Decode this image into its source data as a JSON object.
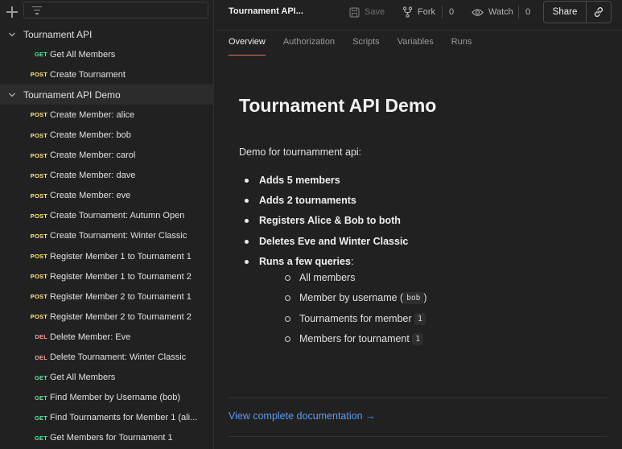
{
  "sidebar": {
    "filter_placeholder": "",
    "items": [
      {
        "kind": "folder",
        "label": "Tournament API",
        "active": false
      },
      {
        "kind": "req",
        "method": "GET",
        "label": "Get All Members"
      },
      {
        "kind": "req",
        "method": "POST",
        "label": "Create Tournament"
      },
      {
        "kind": "folder",
        "label": "Tournament API Demo",
        "active": true
      },
      {
        "kind": "req",
        "method": "POST",
        "label": "Create Member: alice"
      },
      {
        "kind": "req",
        "method": "POST",
        "label": "Create Member: bob"
      },
      {
        "kind": "req",
        "method": "POST",
        "label": "Create Member: carol"
      },
      {
        "kind": "req",
        "method": "POST",
        "label": "Create Member: dave"
      },
      {
        "kind": "req",
        "method": "POST",
        "label": "Create Member: eve"
      },
      {
        "kind": "req",
        "method": "POST",
        "label": "Create Tournament: Autumn Open"
      },
      {
        "kind": "req",
        "method": "POST",
        "label": "Create Tournament: Winter Classic"
      },
      {
        "kind": "req",
        "method": "POST",
        "label": "Register Member 1 to Tournament 1"
      },
      {
        "kind": "req",
        "method": "POST",
        "label": "Register Member 1 to Tournament 2"
      },
      {
        "kind": "req",
        "method": "POST",
        "label": "Register Member 2 to Tournament 1"
      },
      {
        "kind": "req",
        "method": "POST",
        "label": "Register Member 2 to Tournament 2"
      },
      {
        "kind": "req",
        "method": "DEL",
        "label": "Delete Member: Eve"
      },
      {
        "kind": "req",
        "method": "DEL",
        "label": "Delete Tournament: Winter Classic"
      },
      {
        "kind": "req",
        "method": "GET",
        "label": "Get All Members"
      },
      {
        "kind": "req",
        "method": "GET",
        "label": "Find Member by Username (bob)"
      },
      {
        "kind": "req",
        "method": "GET",
        "label": "Find Tournaments for Member 1 (ali..."
      },
      {
        "kind": "req",
        "method": "GET",
        "label": "Get Members for Tournament 1"
      }
    ]
  },
  "header": {
    "title": "Tournament API...",
    "save_label": "Save",
    "fork_label": "Fork",
    "fork_count": "0",
    "watch_label": "Watch",
    "watch_count": "0",
    "share_label": "Share"
  },
  "tabs": [
    "Overview",
    "Authorization",
    "Scripts",
    "Variables",
    "Runs"
  ],
  "active_tab": "Overview",
  "doc": {
    "title": "Tournament API Demo",
    "description": "Demo for tournamment api:",
    "bullets": [
      "Adds 5 members",
      "Adds 2 tournaments",
      "Registers Alice & Bob to both",
      "Deletes Eve and Winter Classic",
      "Runs a few queries"
    ],
    "bullet_suffix": ":",
    "sub": {
      "all_members": "All members",
      "by_username_prefix": "Member by username (",
      "by_username_code": "bob",
      "by_username_suffix": ")",
      "tournaments_prefix": "Tournaments for member",
      "tournaments_code": "1",
      "members_prefix": "Members for tournament",
      "members_code": "1"
    },
    "link": "View complete documentation →"
  },
  "colors": {
    "accent": "#ff6c37",
    "get": "#6bdd9a",
    "post": "#ffe47e",
    "del": "#f79a8e",
    "link": "#5a9cf2"
  }
}
